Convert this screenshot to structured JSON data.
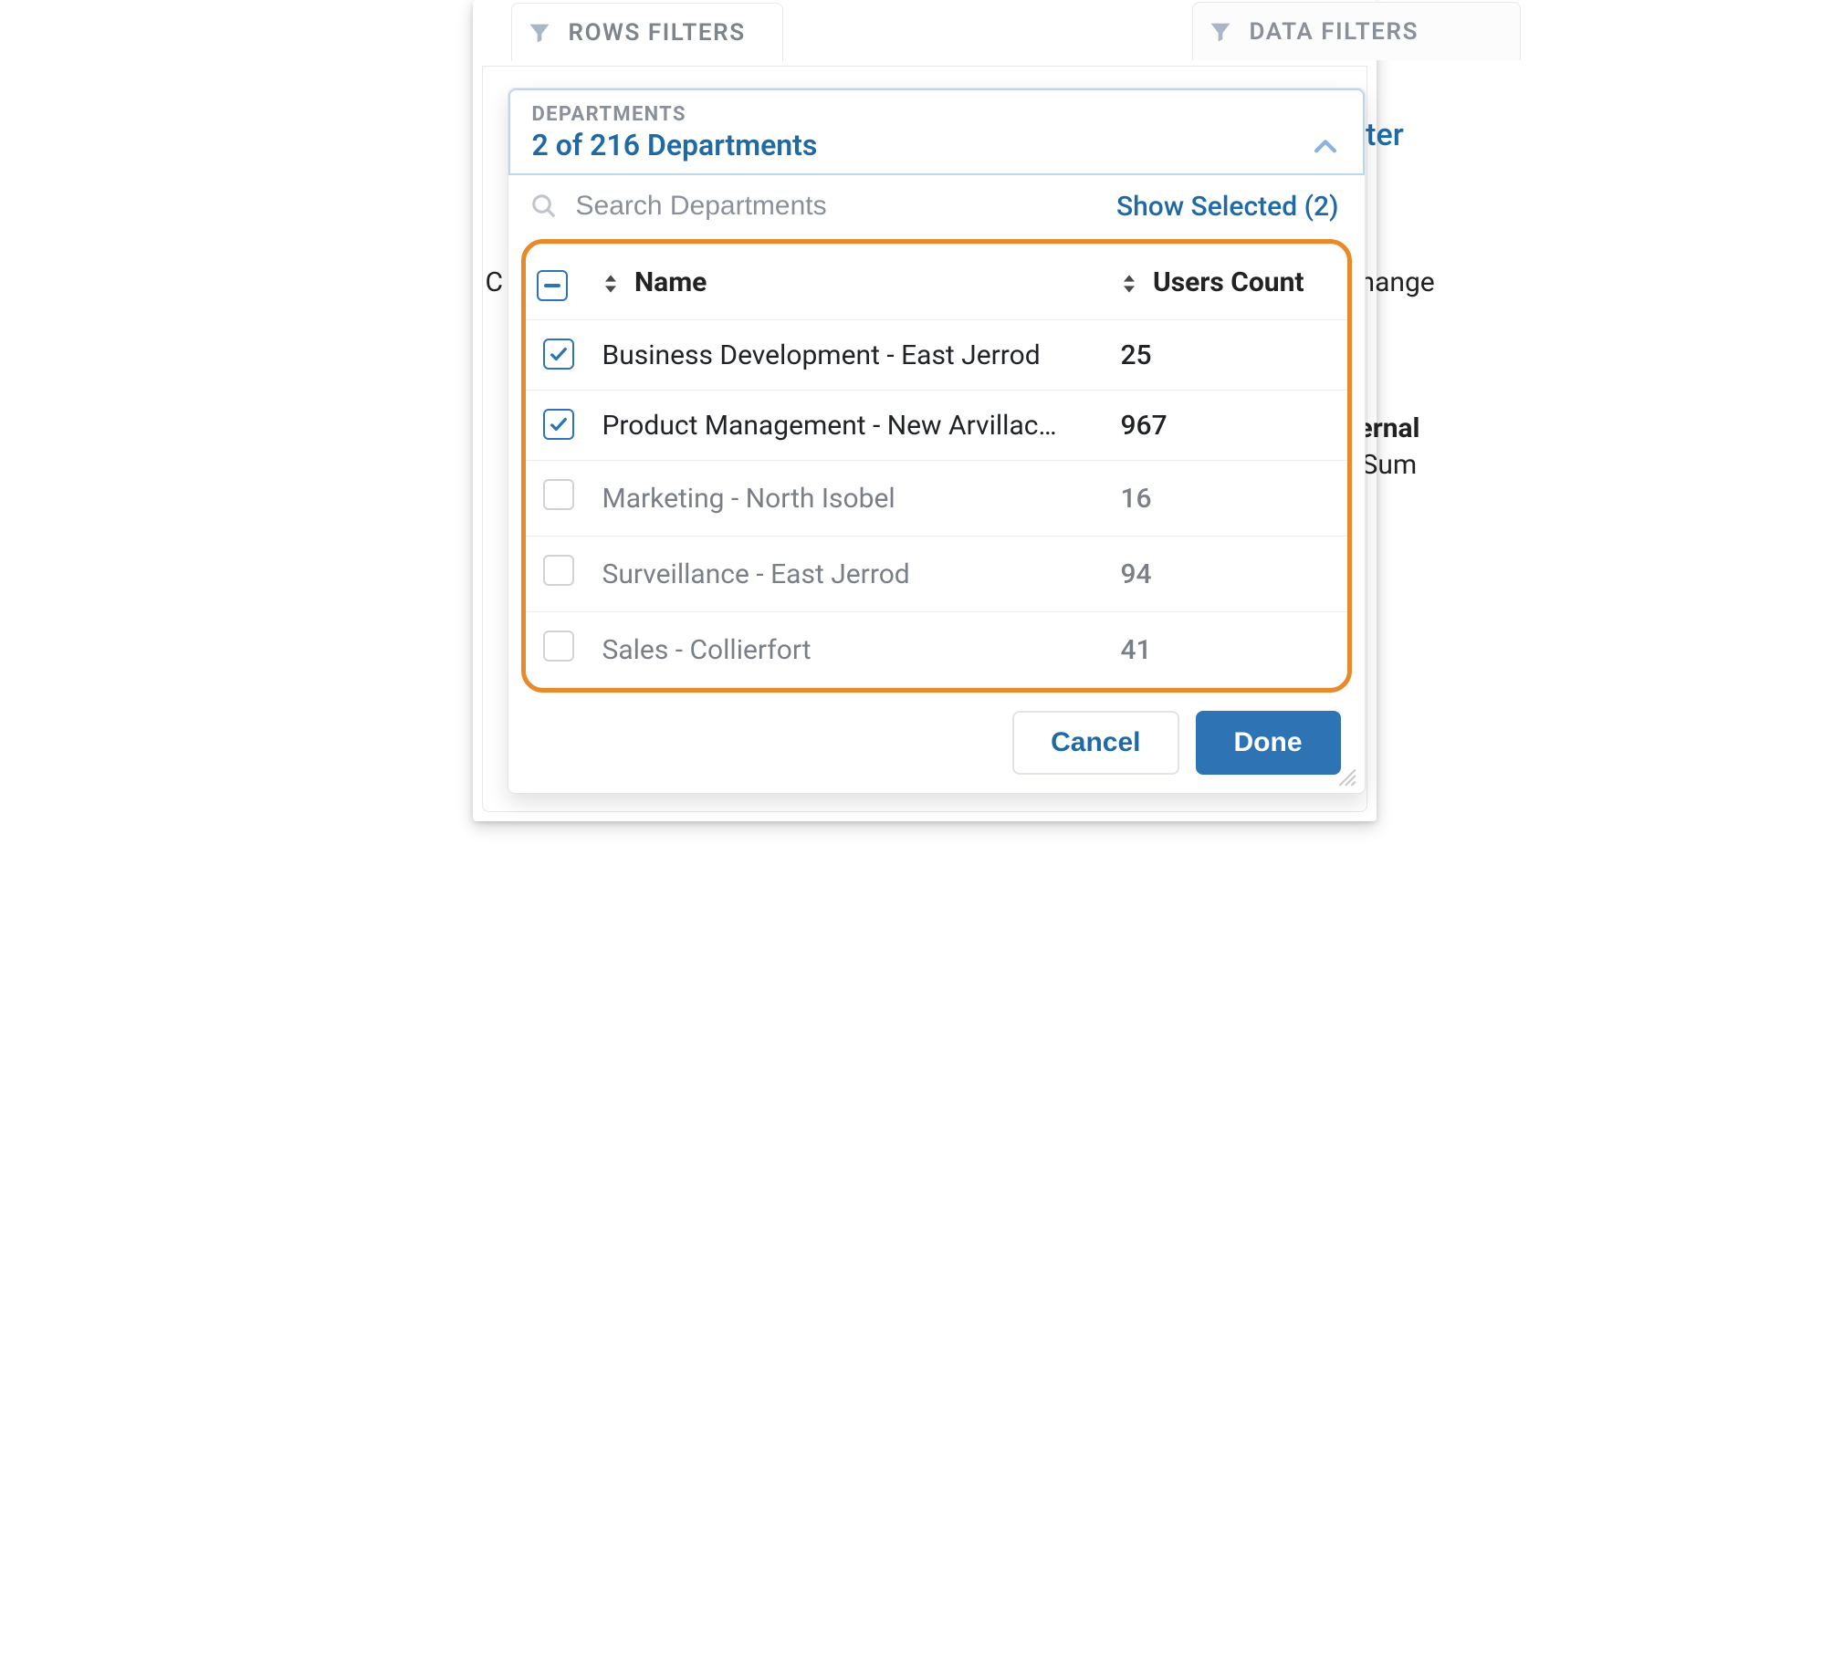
{
  "tabs": {
    "rows_filters": "ROWS FILTERS",
    "data_filters": "DATA FILTERS"
  },
  "picker": {
    "eyebrow": "DEPARTMENTS",
    "summary": "2 of 216 Departments",
    "selected_count": 2,
    "total_count": 216,
    "search_placeholder": "Search Departments",
    "show_selected_label": "Show Selected (2)",
    "columns": {
      "name": "Name",
      "users_count": "Users Count"
    },
    "rows": [
      {
        "checked": true,
        "name": "Business Development - East Jerrod",
        "users_count": "25"
      },
      {
        "checked": true,
        "name": "Product Management - New Arvillac…",
        "users_count": "967"
      },
      {
        "checked": false,
        "name": "Marketing - North Isobel",
        "users_count": "16"
      },
      {
        "checked": false,
        "name": "Surveillance - East Jerrod",
        "users_count": "94"
      },
      {
        "checked": false,
        "name": "Sales - Collierfort",
        "users_count": "41"
      }
    ],
    "buttons": {
      "cancel": "Cancel",
      "done": "Done"
    }
  },
  "background_fragments": {
    "filter_suffix": "lter",
    "change_suffix": "nange",
    "c_prefix": "C",
    "ernal": "ernal",
    "sum": "Sum"
  },
  "colors": {
    "accent": "#2e74b5",
    "highlight_border": "#e88a2a"
  }
}
